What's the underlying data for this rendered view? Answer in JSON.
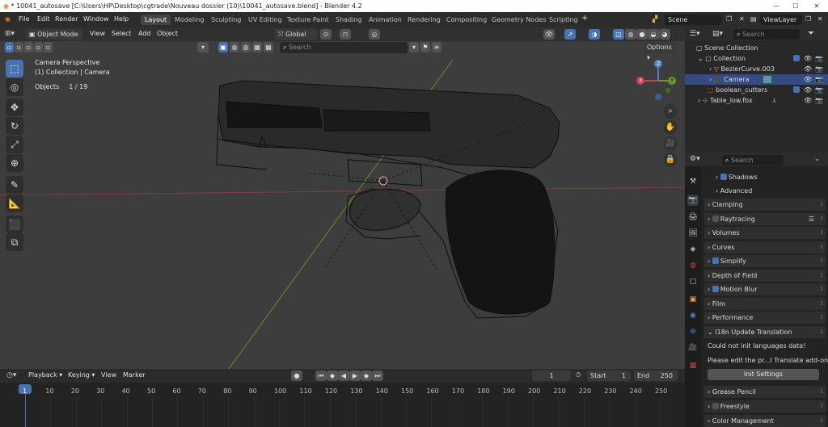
{
  "window": {
    "title": "* 10041_autosave [C:\\Users\\HP\\Desktop\\cgtrade\\Nouveau dossier (10)\\10041_autosave.blend] - Blender 4.2"
  },
  "menus": [
    "File",
    "Edit",
    "Render",
    "Window",
    "Help"
  ],
  "workspaces": [
    "Layout",
    "Modeling",
    "Sculpting",
    "UV Editing",
    "Texture Paint",
    "Shading",
    "Animation",
    "Rendering",
    "Compositing",
    "Geometry Nodes",
    "Scripting"
  ],
  "active_workspace": "Layout",
  "scene": {
    "name": "Scene",
    "view_layer": "ViewLayer"
  },
  "viewport": {
    "mode": "Object Mode",
    "header_menus": [
      "View",
      "Select",
      "Add",
      "Object"
    ],
    "orientation": "Global",
    "options_label": "Options",
    "search_placeholder": "Search",
    "overlay_info": {
      "line1": "Camera Perspective",
      "line2": "(1) Collection | Camera",
      "objects_label": "Objects",
      "objects_value": "1 / 19"
    },
    "gizmo": {
      "x": "X",
      "y": "Y",
      "z": "Z"
    }
  },
  "timeline": {
    "menus": [
      "Playback",
      "Keying",
      "View",
      "Marker"
    ],
    "current_frame": "1",
    "start_label": "Start",
    "start": "1",
    "end_label": "End",
    "end": "250",
    "ticks": [
      "1",
      "10",
      "20",
      "30",
      "40",
      "50",
      "60",
      "70",
      "80",
      "90",
      "100",
      "110",
      "120",
      "130",
      "140",
      "150",
      "160",
      "170",
      "180",
      "190",
      "200",
      "210",
      "220",
      "230",
      "240",
      "250"
    ]
  },
  "outliner": {
    "search_placeholder": "Search",
    "root": "Scene Collection",
    "items": [
      {
        "label": "Collection"
      },
      {
        "label": "BezierCurve.003"
      },
      {
        "label": "Camera"
      },
      {
        "label": "boolean_cutters"
      },
      {
        "label": "Table_low.fbx"
      }
    ]
  },
  "properties": {
    "search_placeholder": "Search",
    "panels": [
      "Shadows",
      "Advanced",
      "Clamping",
      "Raytracing",
      "Volumes",
      "Curves",
      "Simplify",
      "Depth of Field",
      "Motion Blur",
      "Film",
      "Performance",
      "I18n Update Translation"
    ],
    "i18n_msg1": "Could not init languages data!",
    "i18n_msg2": "Please edit the pr...I Translate add-on",
    "init_button": "Init Settings",
    "panels_bottom": [
      "Grease Pencil",
      "Freestyle",
      "Color Management"
    ]
  },
  "colors": {
    "accent": "#4772b3",
    "selected_row": "#334d80"
  }
}
